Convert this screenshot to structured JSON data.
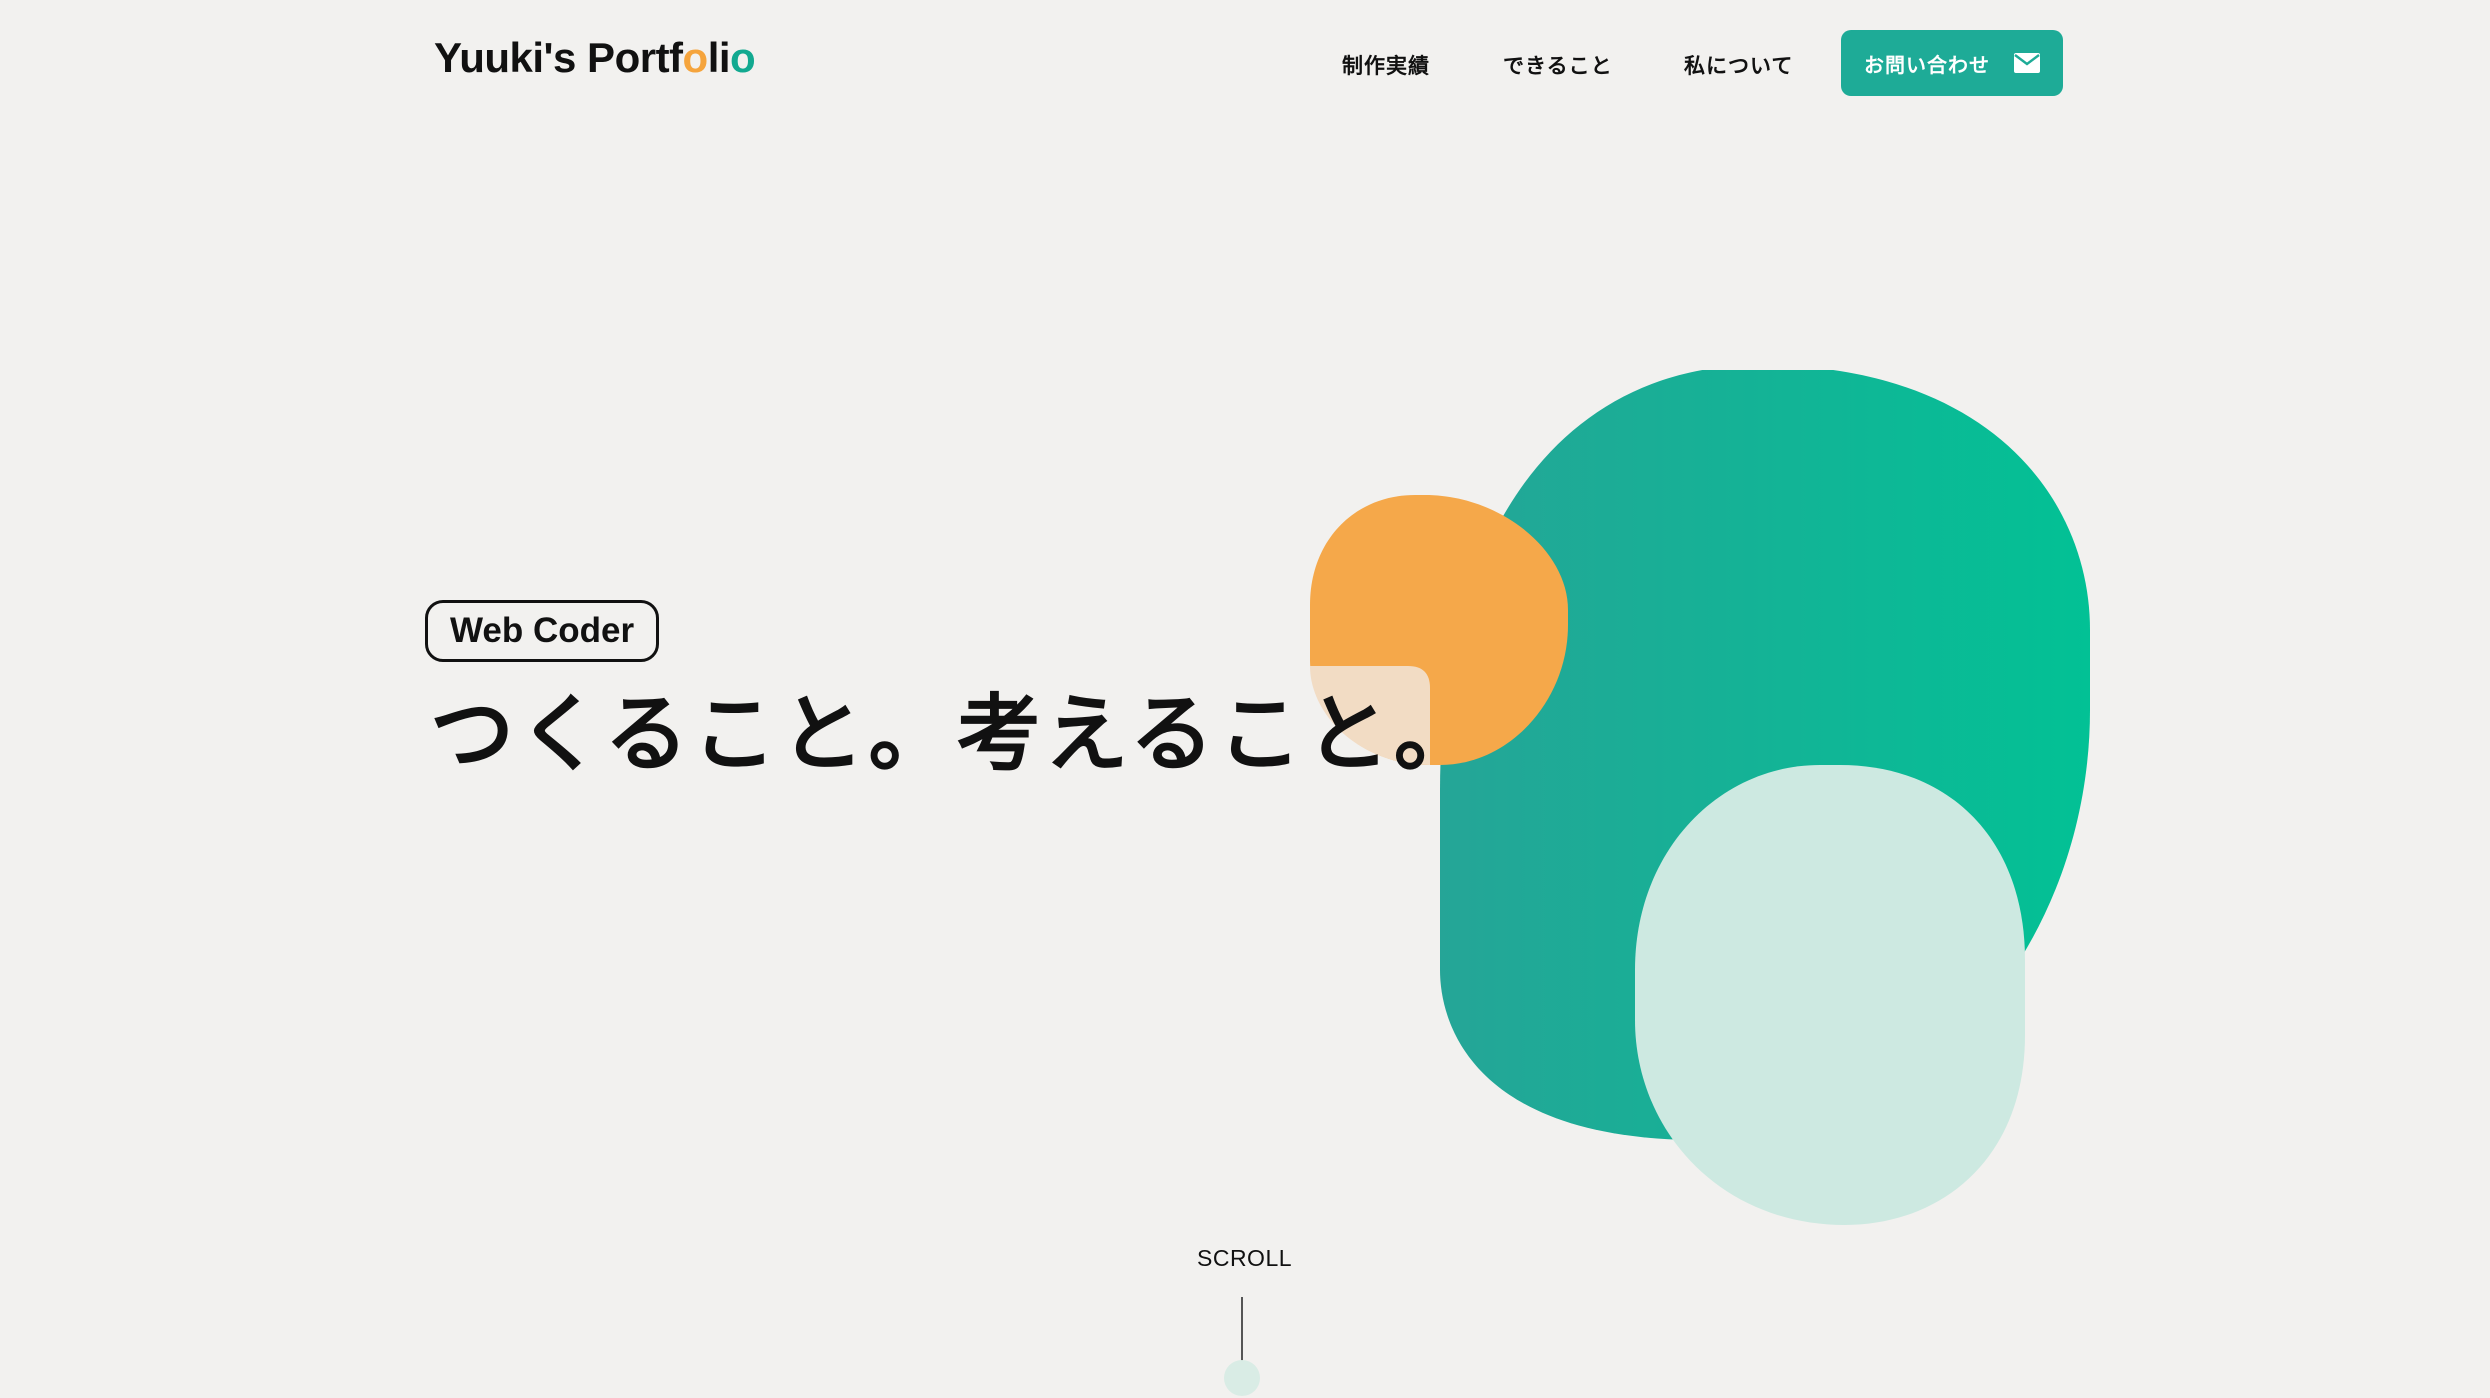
{
  "header": {
    "logo": {
      "prefix": "Yuuki's Portf",
      "o1": "o",
      "middle": "li",
      "o2": "o"
    },
    "nav": [
      {
        "label": "制作実績"
      },
      {
        "label": "できること"
      },
      {
        "label": "私について"
      }
    ],
    "contact": {
      "label": "お問い合わせ",
      "icon": "mail-icon"
    }
  },
  "hero": {
    "badge": "Web Coder",
    "headline": "つくること。考えること。"
  },
  "scroll": {
    "label": "SCROLL"
  },
  "colors": {
    "background": "#f2f1ef",
    "accent": "#1eab97",
    "orange": "#f5a43c",
    "mint": "#cde9e1",
    "peach": "#f2dcc4",
    "text": "#111111"
  }
}
